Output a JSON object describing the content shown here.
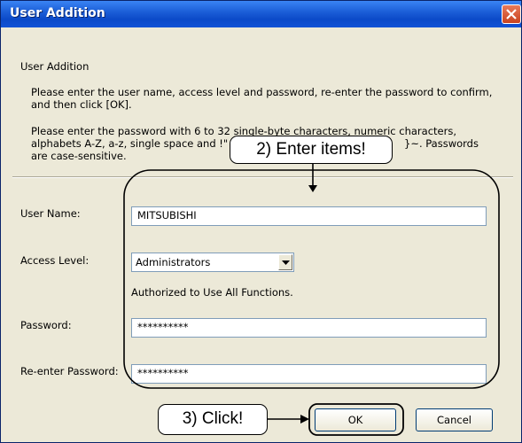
{
  "dialog": {
    "title": "User Addition",
    "section_heading": "User Addition",
    "instructions": [
      "Please enter the user name, access level and password, re-enter the password to confirm,",
      "and then click [OK].",
      "Please enter the password with 6 to 32 single-byte characters, numeric characters,",
      "alphabets A-Z, a-z, single space and  !\"",
      "}~. Passwords",
      "are case-sensitive."
    ]
  },
  "form": {
    "user_name_label": "User Name:",
    "user_name_value": "MITSUBISHI",
    "access_level_label": "Access Level:",
    "access_level_value": "Administrators",
    "access_level_desc": "Authorized to Use All Functions.",
    "password_label": "Password:",
    "password_value": "**********",
    "reenter_label": "Re-enter Password:",
    "reenter_value": "**********"
  },
  "buttons": {
    "ok": "OK",
    "cancel": "Cancel"
  },
  "annotations": {
    "enter_items": "2) Enter items!",
    "click": "3) Click!"
  },
  "icons": {
    "close": "close-icon",
    "dropdown": "chevron-down-icon"
  },
  "colors": {
    "titlebar": "#0b49c8",
    "close_button": "#c9431f",
    "dialog_bg": "#ece9d8"
  }
}
